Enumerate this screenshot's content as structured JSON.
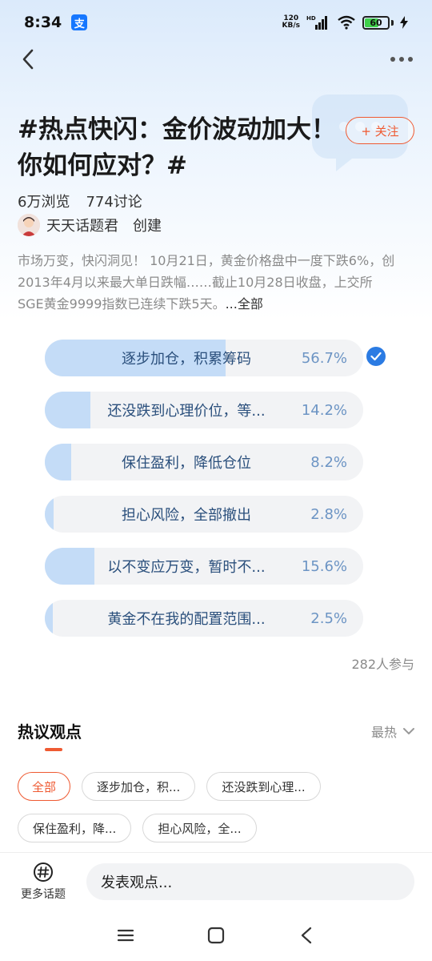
{
  "status_bar": {
    "time": "8:34",
    "app_icon_text": "支",
    "net_speed_value": "120",
    "net_speed_unit": "KB/s",
    "signal_label": "HD",
    "battery": "60",
    "battery_level": 0.6
  },
  "nav": {
    "back_icon": "chevron-left-icon",
    "more_icon": "more-dots-icon"
  },
  "topic": {
    "title": "#热点快闪：金价波动加大！你如何应对？#",
    "follow_label": "+ 关注",
    "views": "6万浏览",
    "discussions": "774讨论",
    "creator_name": "天天话题君",
    "creator_action": "创建",
    "description": "市场万变，快闪洞见！ 10月21日，黄金价格盘中一度下跌6%，创2013年4月以来最大单日跌幅……截止10月28日收盘，上交所SGE黄金9999指数已连续下跌5天。",
    "description_more": "...全部"
  },
  "poll": {
    "options": [
      {
        "label": "逐步加仓，积累筹码",
        "percent": "56.7%",
        "value": 56.7,
        "selected": true
      },
      {
        "label": "还没跌到心理价位，等...",
        "percent": "14.2%",
        "value": 14.2,
        "selected": false
      },
      {
        "label": "保住盈利，降低仓位",
        "percent": "8.2%",
        "value": 8.2,
        "selected": false
      },
      {
        "label": "担心风险，全部撤出",
        "percent": "2.8%",
        "value": 2.8,
        "selected": false
      },
      {
        "label": "以不变应万变，暂时不...",
        "percent": "15.6%",
        "value": 15.6,
        "selected": false
      },
      {
        "label": "黄金不在我的配置范围...",
        "percent": "2.5%",
        "value": 2.5,
        "selected": false
      }
    ],
    "participants": "282人参与"
  },
  "hot": {
    "title": "热议观点",
    "sort_label": "最热",
    "chips_row1": [
      "全部",
      "逐步加仓，积...",
      "还没跌到心理..."
    ],
    "chips_row2": [
      "保住盈利，降...",
      "担心风险，全..."
    ]
  },
  "bottom": {
    "more_topics_label": "更多话题",
    "comment_placeholder": "发表观点..."
  },
  "colors": {
    "accent": "#ef5a32",
    "poll_fill": "#c4dcf7",
    "poll_track": "#f2f3f5",
    "check": "#2b7be3"
  }
}
